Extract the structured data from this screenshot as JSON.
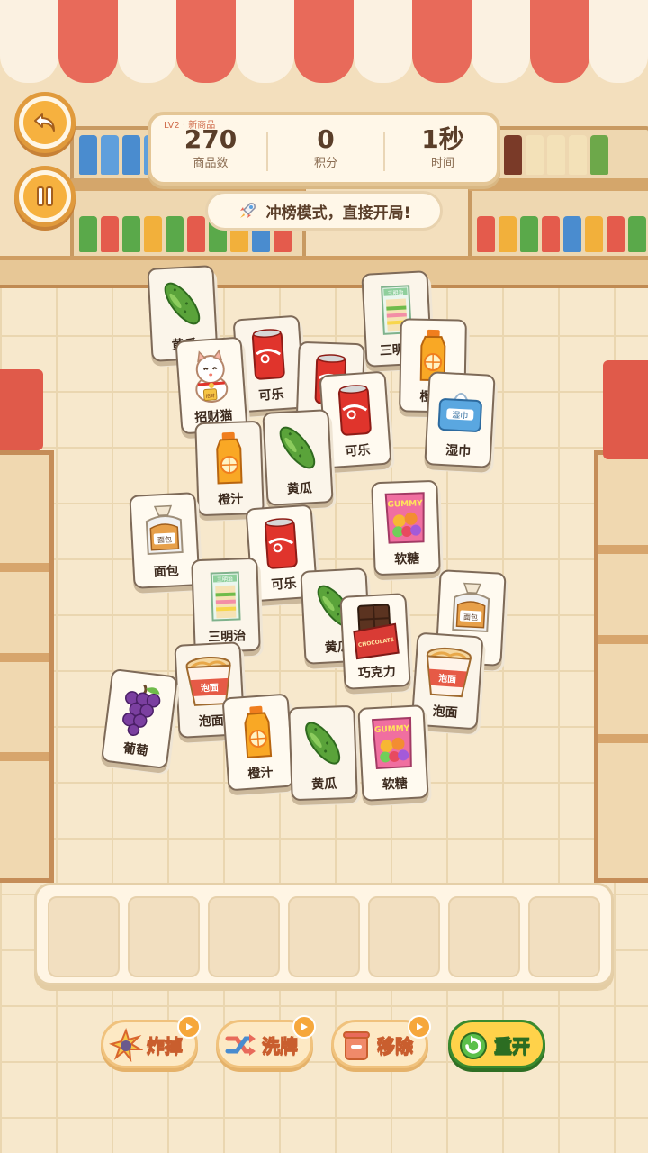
{
  "hud": {
    "level_tag": "LV2 · 新商品",
    "items_count": "270",
    "items_label": "商品数",
    "score": "0",
    "score_label": "积分",
    "time": "1秒",
    "time_label": "时间"
  },
  "banner": {
    "text": "冲榜模式，直接开局!"
  },
  "tiles": [
    {
      "label": "黄瓜",
      "icon": "cucumber-icon"
    },
    {
      "label": "可乐",
      "icon": "cola-can-icon"
    },
    {
      "label": "可乐",
      "icon": "cola-can-icon"
    },
    {
      "label": "三明治",
      "icon": "sandwich-icon"
    },
    {
      "label": "招财猫",
      "icon": "lucky-cat-icon"
    },
    {
      "label": "橙汁",
      "icon": "orange-juice-icon"
    },
    {
      "label": "可乐",
      "icon": "cola-can-icon"
    },
    {
      "label": "湿巾",
      "icon": "wet-wipes-icon"
    },
    {
      "label": "橙汁",
      "icon": "orange-juice-icon"
    },
    {
      "label": "黄瓜",
      "icon": "cucumber-icon"
    },
    {
      "label": "软糖",
      "icon": "gummy-candy-icon"
    },
    {
      "label": "面包",
      "icon": "bread-icon"
    },
    {
      "label": "可乐",
      "icon": "cola-can-icon"
    },
    {
      "label": "三明治",
      "icon": "sandwich-icon"
    },
    {
      "label": "黄瓜",
      "icon": "cucumber-icon"
    },
    {
      "label": "巧克力",
      "icon": "chocolate-icon"
    },
    {
      "label": "面包",
      "icon": "bread-icon"
    },
    {
      "label": "泡面",
      "icon": "instant-noodle-icon"
    },
    {
      "label": "泡面",
      "icon": "instant-noodle-icon"
    },
    {
      "label": "葡萄",
      "icon": "grapes-icon"
    },
    {
      "label": "橙汁",
      "icon": "orange-juice-icon"
    },
    {
      "label": "黄瓜",
      "icon": "cucumber-icon"
    },
    {
      "label": "软糖",
      "icon": "gummy-candy-icon"
    }
  ],
  "art_text": {
    "gummy": "GUMMY",
    "chocolate": "CHOCOLATE",
    "noodle": "泡面",
    "bread": "面包",
    "wipes": "湿巾",
    "sandwich": "三明治",
    "cat": "招财"
  },
  "tray": {
    "slots": 7
  },
  "powerups": [
    {
      "label": "炸掉",
      "icon": "bomb-icon"
    },
    {
      "label": "洗牌",
      "icon": "shuffle-icon"
    },
    {
      "label": "移除",
      "icon": "remove-icon"
    },
    {
      "label": "重开",
      "icon": "restart-icon"
    }
  ],
  "colors": {
    "accent": "#f6b13f",
    "awning_red": "#e86a5a",
    "tile_border": "#7e6a58",
    "restart_green": "#3a8a2e"
  }
}
